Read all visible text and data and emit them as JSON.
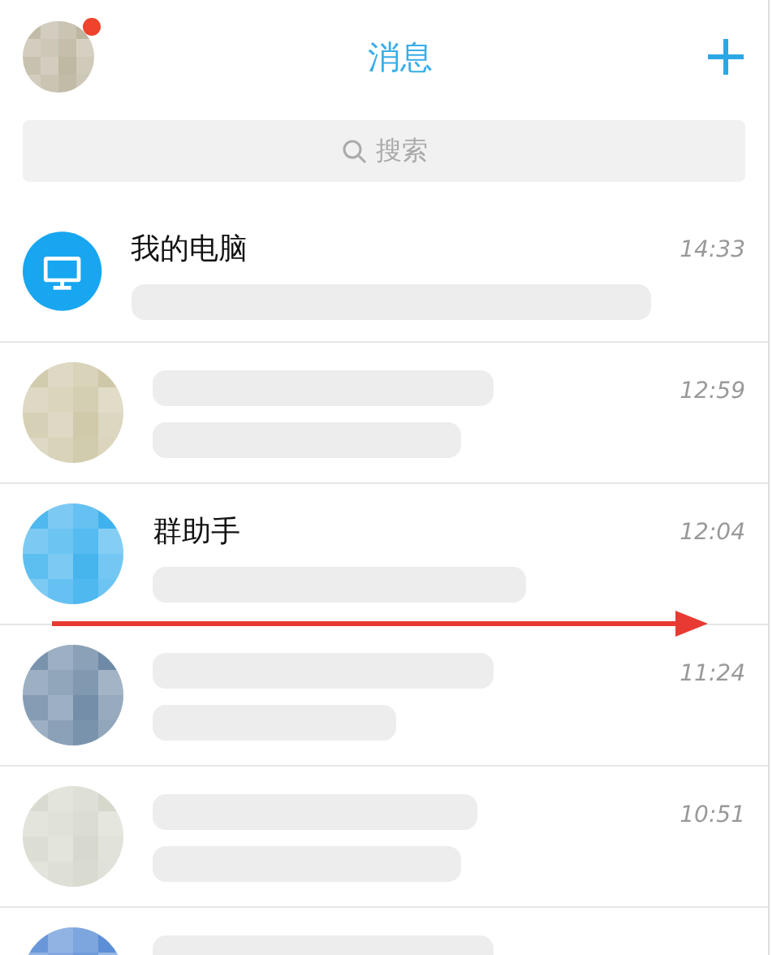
{
  "header": {
    "title": "消息",
    "has_notification": true
  },
  "search": {
    "placeholder": "搜索"
  },
  "chats": [
    {
      "kind": "computer",
      "name": "我的电脑",
      "time": "14:33"
    },
    {
      "kind": "mosaic",
      "color": "#cfc8a8",
      "time": "12:59"
    },
    {
      "kind": "mosaic",
      "color": "#3fb2ee",
      "name": "群助手",
      "time": "12:04"
    },
    {
      "kind": "mosaic",
      "color": "#6f8aa6",
      "time": "11:24"
    },
    {
      "kind": "mosaic",
      "color": "#d6d8cc",
      "time": "10:51"
    },
    {
      "kind": "mosaic",
      "color": "#5d8fd6"
    }
  ],
  "swipe_arrow": true
}
